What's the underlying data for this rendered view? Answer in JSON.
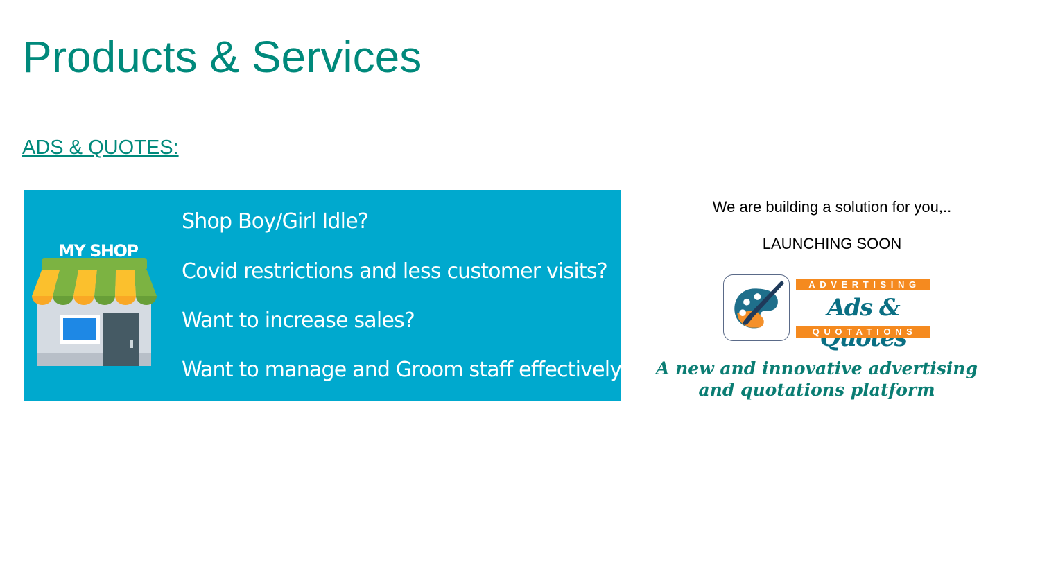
{
  "page": {
    "title": "Products & Services"
  },
  "section": {
    "link_label": "ADS & QUOTES:"
  },
  "promo": {
    "shop_label": "MY SHOP",
    "questions": [
      "Shop Boy/Girl Idle?",
      "Covid restrictions and less customer visits?",
      "Want to increase sales?",
      "Want to manage and Groom staff effectively?"
    ]
  },
  "announcement": {
    "building": "We are building a solution for you,..",
    "launch": "LAUNCHING SOON",
    "logo": {
      "top_band": "ADVERTISING",
      "script": "Ads & Quotes",
      "bottom_band": "QUOTATIONS"
    },
    "tagline_line1": "A new and innovative advertising",
    "tagline_line2": "and quotations platform"
  },
  "colors": {
    "title": "#00897b",
    "promo_background": "#00a9ce",
    "logo_orange": "#f58a1f",
    "logo_teal": "#0a6f83",
    "tagline": "#0a7d73"
  },
  "icons": [
    "shop-icon",
    "palette-brush-icon"
  ]
}
